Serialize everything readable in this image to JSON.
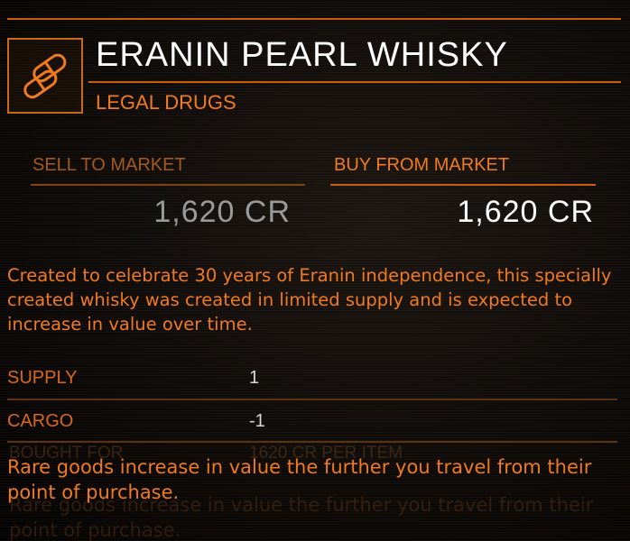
{
  "item": {
    "name": "ERANIN PEARL WHISKY",
    "category": "LEGAL DRUGS",
    "icon": "pill-capsules-icon"
  },
  "market": {
    "sell_label": "SELL TO MARKET",
    "sell_price": "1,620 CR",
    "buy_label": "BUY FROM MARKET",
    "buy_price": "1,620 CR"
  },
  "description": "Created to celebrate 30 years of Eranin independence, this specially created whisky was created in limited supply and is expected to increase in value over time.",
  "stats": [
    {
      "label": "SUPPLY",
      "value": "1"
    },
    {
      "label": "CARGO",
      "value": "-1"
    }
  ],
  "ghost": {
    "bought_for": "BOUGHT FOR",
    "bought_value": "1620 CR PER ITEM"
  },
  "footer_note": "Rare goods increase in value the further you travel from their point of purchase.",
  "colors": {
    "accent": "#f07a1e",
    "rule": "#c85d12",
    "background": "#0a0705",
    "title": "#ffffff"
  }
}
